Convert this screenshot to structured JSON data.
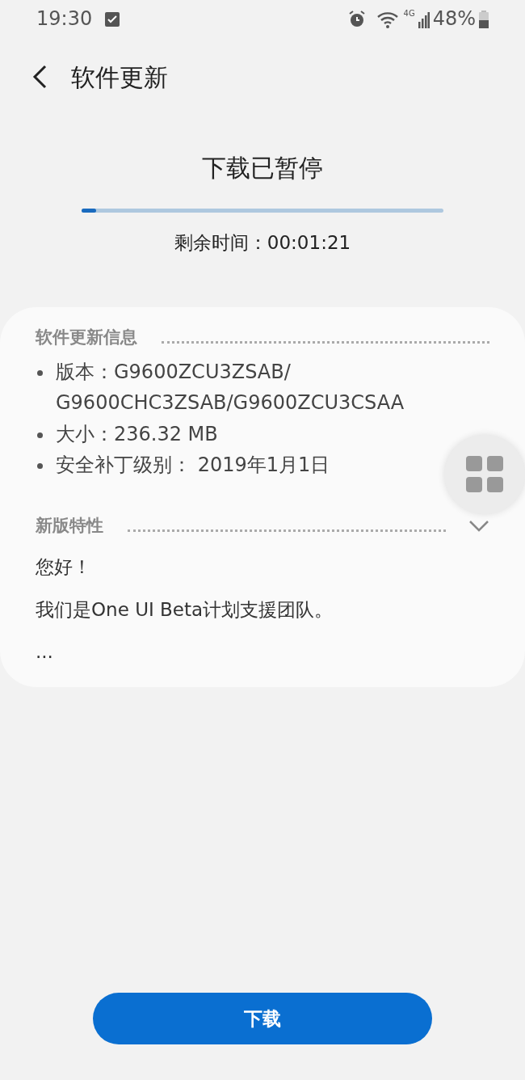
{
  "status_bar": {
    "time": "19:30",
    "network": "4G",
    "battery": "48%"
  },
  "header": {
    "title": "软件更新"
  },
  "download": {
    "status": "下载已暂停",
    "level": 0.04,
    "remaining": "剩余时间：00:01:21"
  },
  "info": {
    "title": "软件更新信息",
    "items": [
      "版本：G9600ZCU3ZSAB/\nG9600CHC3ZSAB/G9600ZCU3CSAA",
      "大小：236.32 MB",
      "安全补丁级别： 2019年1月1日"
    ]
  },
  "features": {
    "title": "新版特性",
    "expanded": false,
    "lines": [
      "您好！",
      "我们是One UI Beta计划支援团队。",
      "..."
    ]
  },
  "button": {
    "label": "下载"
  }
}
